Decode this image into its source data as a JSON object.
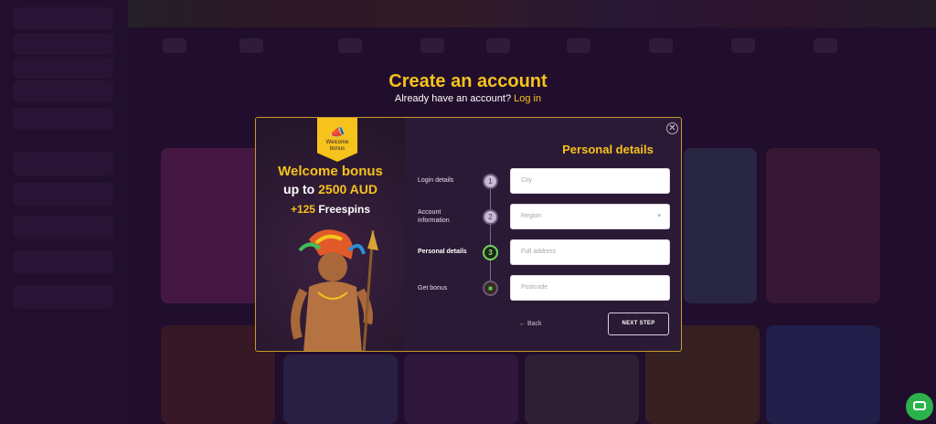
{
  "header": {
    "title": "Create an account",
    "subtitle_prefix": "Already have an account?",
    "login_link": "Log in"
  },
  "promo": {
    "ribbon_line1": "Welcome",
    "ribbon_line2": "bonus",
    "headline": "Welcome bonus",
    "amount_prefix": "up to",
    "amount": "2500 AUD",
    "freespins_amount": "+125",
    "freespins_label": "Freespins"
  },
  "form": {
    "section_title": "Personal details",
    "steps": [
      {
        "number": "1",
        "label": "Login details"
      },
      {
        "number": "2",
        "label": "Account information"
      },
      {
        "number": "3",
        "label": "Personal details"
      },
      {
        "number": "",
        "label": "Get bonus"
      }
    ],
    "fields": {
      "city_placeholder": "City",
      "region_placeholder": "Region",
      "address_placeholder": "Full address",
      "postcode_placeholder": "Postcode"
    },
    "back_label": "Back",
    "next_label": "NEXT STEP"
  },
  "icons": {
    "close": "close-icon",
    "back_arrow": "arrow-left-icon",
    "chevron": "chevron-down-icon",
    "gift": "gift-icon",
    "megaphone": "megaphone-icon",
    "chat": "chat-icon"
  },
  "colors": {
    "accent": "#f6c21c",
    "active_step": "#6fd65a",
    "modal_bg": "#2b1a36",
    "chat": "#2bb34a"
  }
}
